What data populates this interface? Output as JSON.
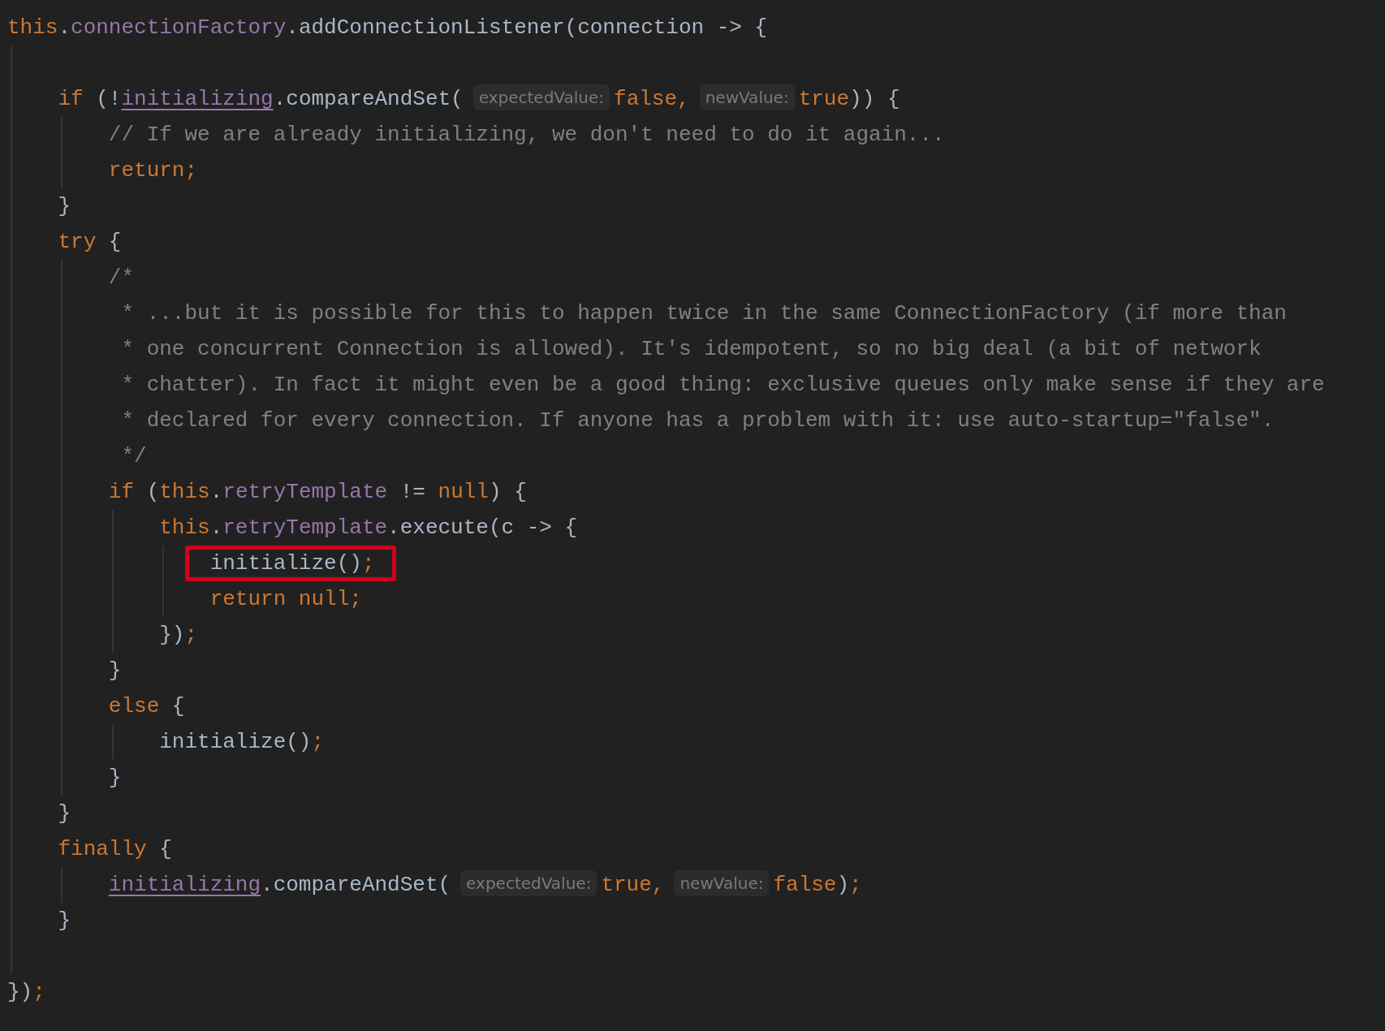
{
  "editor": {
    "lines": [
      {
        "highlighted": false,
        "tokens": [
          {
            "kind": "keyword",
            "text": "this"
          },
          {
            "kind": "plain",
            "text": "."
          },
          {
            "kind": "field",
            "text": "connectionFactory"
          },
          {
            "kind": "plain",
            "text": ".addConnectionListener(connection -> {"
          }
        ]
      },
      {
        "highlighted": false
      },
      {
        "highlighted": false,
        "tokens": [
          {
            "kind": "keyword",
            "text": "    if"
          },
          {
            "kind": "plain",
            "text": " (!"
          },
          {
            "kind": "mutable",
            "text": "initializing"
          },
          {
            "kind": "plain",
            "text": ".compareAndSet("
          },
          {
            "kind": "hint",
            "text": "expectedValue:"
          },
          {
            "kind": "keyword",
            "text": "false,"
          },
          {
            "kind": "hint",
            "text": "newValue:"
          },
          {
            "kind": "keyword",
            "text": "true"
          },
          {
            "kind": "plain",
            "text": ")) {"
          }
        ]
      },
      {
        "highlighted": false,
        "tokens": [
          {
            "kind": "comment",
            "text": "        // If we are already initializing, we don't need to do it again..."
          }
        ]
      },
      {
        "highlighted": false,
        "tokens": [
          {
            "kind": "keyword",
            "text": "        return;"
          }
        ]
      },
      {
        "highlighted": false,
        "tokens": [
          {
            "kind": "plain",
            "text": "    }"
          }
        ]
      },
      {
        "highlighted": false,
        "tokens": [
          {
            "kind": "keyword",
            "text": "    try"
          },
          {
            "kind": "plain",
            "text": " {"
          }
        ]
      },
      {
        "highlighted": false,
        "tokens": [
          {
            "kind": "comment",
            "text": "        /*"
          }
        ]
      },
      {
        "highlighted": false,
        "tokens": [
          {
            "kind": "comment",
            "text": "         * ...but it is possible for this to happen twice in the same ConnectionFactory (if more than"
          }
        ]
      },
      {
        "highlighted": false,
        "tokens": [
          {
            "kind": "comment",
            "text": "         * one concurrent Connection is allowed). It's idempotent, so no big deal (a bit of network"
          }
        ]
      },
      {
        "highlighted": false,
        "tokens": [
          {
            "kind": "comment",
            "text": "         * chatter). In fact it might even be a good thing: exclusive queues only make sense if they are"
          }
        ]
      },
      {
        "highlighted": false,
        "tokens": [
          {
            "kind": "comment",
            "text": "         * declared for every connection. If anyone has a problem with it: use auto-startup=\"false\"."
          }
        ]
      },
      {
        "highlighted": false,
        "tokens": [
          {
            "kind": "comment",
            "text": "         */"
          }
        ]
      },
      {
        "highlighted": false,
        "tokens": [
          {
            "kind": "keyword",
            "text": "        if"
          },
          {
            "kind": "plain",
            "text": " ("
          },
          {
            "kind": "keyword",
            "text": "this"
          },
          {
            "kind": "plain",
            "text": "."
          },
          {
            "kind": "field",
            "text": "retryTemplate"
          },
          {
            "kind": "plain",
            "text": " != "
          },
          {
            "kind": "keyword",
            "text": "null"
          },
          {
            "kind": "plain",
            "text": ") {"
          }
        ]
      },
      {
        "highlighted": false,
        "tokens": [
          {
            "kind": "keyword",
            "text": "            this"
          },
          {
            "kind": "plain",
            "text": "."
          },
          {
            "kind": "field",
            "text": "retryTemplate"
          },
          {
            "kind": "plain",
            "text": ".execute(c -> {"
          }
        ]
      },
      {
        "highlighted": true,
        "tokens": [
          {
            "kind": "plain",
            "text": "                initialize()"
          },
          {
            "kind": "keyword",
            "text": ";"
          }
        ]
      },
      {
        "highlighted": false,
        "tokens": [
          {
            "kind": "keyword",
            "text": "                return null;"
          }
        ]
      },
      {
        "highlighted": false,
        "tokens": [
          {
            "kind": "plain",
            "text": "            })"
          },
          {
            "kind": "keyword",
            "text": ";"
          }
        ]
      },
      {
        "highlighted": false,
        "tokens": [
          {
            "kind": "plain",
            "text": "        }"
          }
        ]
      },
      {
        "highlighted": false,
        "tokens": [
          {
            "kind": "keyword",
            "text": "        else"
          },
          {
            "kind": "plain",
            "text": " {"
          }
        ]
      },
      {
        "highlighted": false,
        "tokens": [
          {
            "kind": "plain",
            "text": "            initialize()"
          },
          {
            "kind": "keyword",
            "text": ";"
          }
        ]
      },
      {
        "highlighted": false,
        "tokens": [
          {
            "kind": "plain",
            "text": "        }"
          }
        ]
      },
      {
        "highlighted": false,
        "tokens": [
          {
            "kind": "plain",
            "text": "    }"
          }
        ]
      },
      {
        "highlighted": false,
        "tokens": [
          {
            "kind": "keyword",
            "text": "    finally"
          },
          {
            "kind": "plain",
            "text": " {"
          }
        ]
      },
      {
        "highlighted": false,
        "tokens": [
          {
            "kind": "mutable",
            "text": "        initializing"
          },
          {
            "kind": "plain",
            "text": ".compareAndSet("
          },
          {
            "kind": "hint",
            "text": "expectedValue:"
          },
          {
            "kind": "keyword",
            "text": "true,"
          },
          {
            "kind": "hint",
            "text": "newValue:"
          },
          {
            "kind": "keyword",
            "text": "false"
          },
          {
            "kind": "plain",
            "text": ")"
          },
          {
            "kind": "keyword",
            "text": ";"
          }
        ]
      },
      {
        "highlighted": false,
        "tokens": [
          {
            "kind": "plain",
            "text": "    }"
          }
        ]
      },
      {
        "highlighted": false
      },
      {
        "highlighted": false,
        "tokens": [
          {
            "kind": "plain",
            "text": "})"
          },
          {
            "kind": "keyword",
            "text": ";"
          }
        ]
      }
    ]
  }
}
